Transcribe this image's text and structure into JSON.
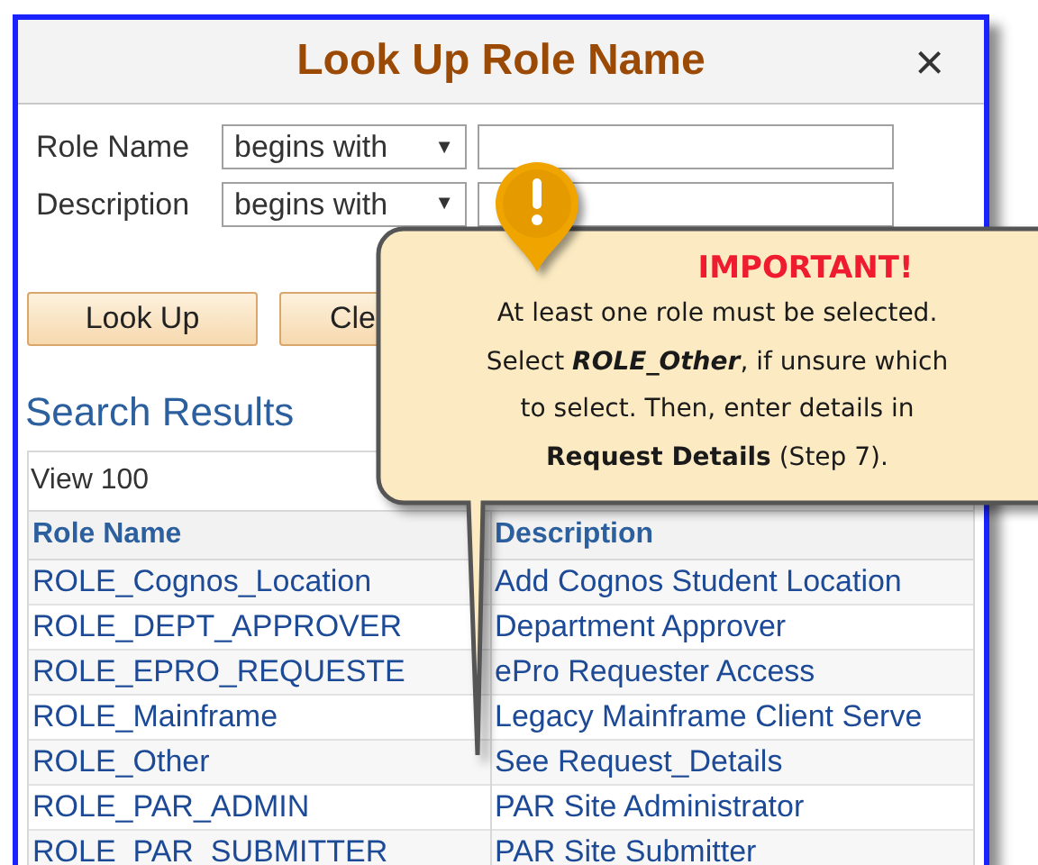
{
  "dialog": {
    "title": "Look Up Role Name",
    "close": "×"
  },
  "criteria": [
    {
      "label": "Role Name",
      "operator": "begins with",
      "arrow": "▼"
    },
    {
      "label": "Description",
      "operator": "begins with",
      "arrow": "▼"
    }
  ],
  "buttons": [
    {
      "label": "Look Up"
    },
    {
      "label": "Cle"
    }
  ],
  "results": {
    "heading": "Search Results",
    "view": "View 100",
    "columns": [
      "Role Name",
      "Description"
    ],
    "rows": [
      [
        "ROLE_Cognos_Location",
        "Add Cognos Student Location"
      ],
      [
        "ROLE_DEPT_APPROVER",
        "Department Approver"
      ],
      [
        "ROLE_EPRO_REQUESTE",
        "ePro Requester Access"
      ],
      [
        "ROLE_Mainframe",
        "Legacy Mainframe Client Serve"
      ],
      [
        "ROLE_Other",
        "See Request_Details"
      ],
      [
        "ROLE_PAR_ADMIN",
        "PAR Site Administrator"
      ],
      [
        "ROLE_PAR_SUBMITTER",
        "PAR Site Submitter"
      ]
    ]
  },
  "callout": {
    "title": "IMPORTANT!",
    "text": "At least one role must be selected. Select **ROLE_Other**, if unsure which to select. Then, enter details in **Request Details** (Step 7)."
  }
}
